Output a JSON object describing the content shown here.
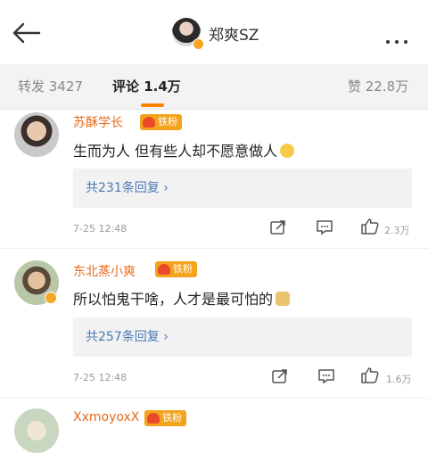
{
  "header": {
    "title": "郑爽SZ",
    "back_icon": "back-arrow-icon",
    "more_icon": "more-dots-icon"
  },
  "tabs": [
    {
      "label": "转发 3427"
    },
    {
      "label": "评论 1.4万"
    },
    {
      "label": "赞 22.8万"
    }
  ],
  "comments": [
    {
      "username": "苏酥学长",
      "fan_badge": "铁粉",
      "text": "生而为人 但有些人却不愿意做人",
      "emoji": "grin-emoji",
      "replies": "共231条回复",
      "time": "7-25 12:48",
      "likes": "2.3万"
    },
    {
      "username": "东北蒸小爽",
      "fan_badge": "铁粉",
      "text": "所以怕鬼干啥，人才是最可怕的",
      "emoji": "face-emoji",
      "replies": "共257条回复",
      "time": "7-25 12:48",
      "likes": "1.6万"
    },
    {
      "username": "XxmoyoxX",
      "fan_badge": "铁粉"
    }
  ],
  "colors": {
    "accent": "#ff8200",
    "username": "#e86b1c",
    "link": "#4a7ab5"
  }
}
